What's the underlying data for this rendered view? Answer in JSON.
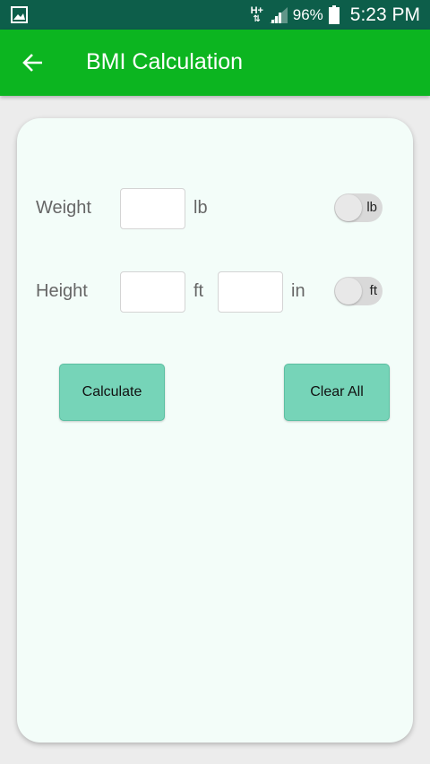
{
  "status_bar": {
    "network": "H+",
    "battery_percent": "96%",
    "time": "5:23 PM",
    "colors": {
      "background": "#0d5e4a"
    }
  },
  "app_bar": {
    "title": "BMI Calculation",
    "back_icon": "arrow-left-icon",
    "colors": {
      "background": "#0cb520"
    }
  },
  "form": {
    "weight": {
      "label": "Weight",
      "value": "",
      "unit": "lb",
      "toggle_text": "lb"
    },
    "height": {
      "label": "Height",
      "feet_value": "",
      "feet_unit": "ft",
      "inches_value": "",
      "inches_unit": "in",
      "toggle_text": "ft"
    }
  },
  "buttons": {
    "calculate": "Calculate",
    "clear_all": "Clear All",
    "colors": {
      "background": "#76d4b8"
    }
  }
}
